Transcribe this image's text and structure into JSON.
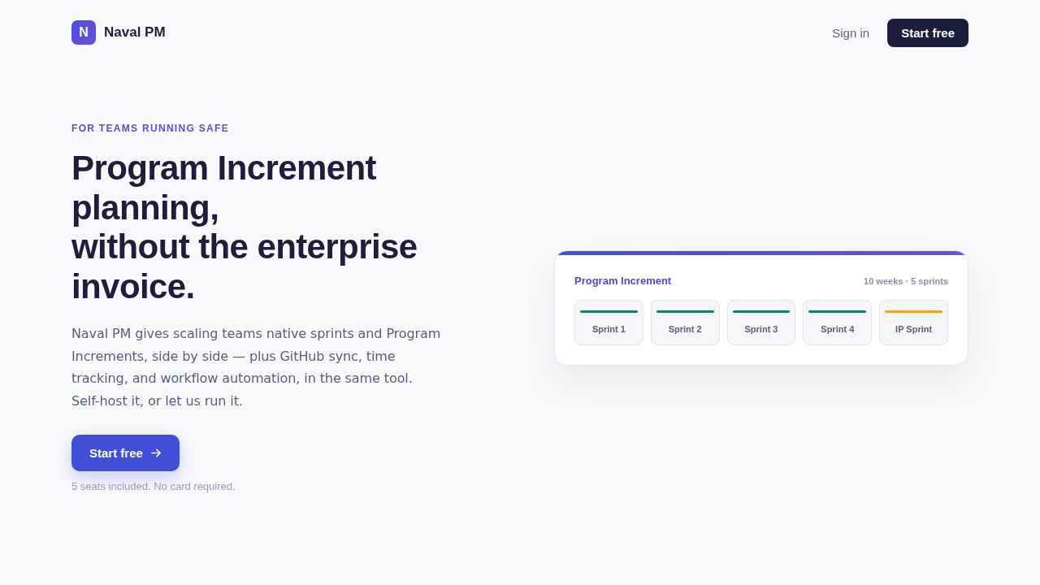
{
  "nav": {
    "logo_letter": "N",
    "brand": "Naval PM",
    "actions": [
      {
        "label": "Sign in",
        "kind": "link"
      },
      {
        "label": "Start free",
        "kind": "button"
      }
    ]
  },
  "hero": {
    "eyebrow": "FOR TEAMS RUNNING SAFE",
    "headline_lines": [
      "Program Increment planning,",
      "without the enterprise invoice."
    ],
    "description": "Naval PM gives scaling teams native sprints and Program Increments, side by side — plus GitHub sync, time tracking, and workflow automation, in the same tool. Self-host it, or let us run it.",
    "cta": {
      "label": "Start free"
    },
    "note": "5 seats included. No card required."
  },
  "pi_card": {
    "title": "Program Increment",
    "meta": "10 weeks · 5 sprints",
    "sprints": [
      {
        "label": "Sprint 1",
        "color": "#13806a"
      },
      {
        "label": "Sprint 2",
        "color": "#13806a"
      },
      {
        "label": "Sprint 3",
        "color": "#13806a"
      },
      {
        "label": "Sprint 4",
        "color": "#13806a"
      },
      {
        "label": "IP Sprint",
        "color": "#f2a22c"
      }
    ]
  }
}
